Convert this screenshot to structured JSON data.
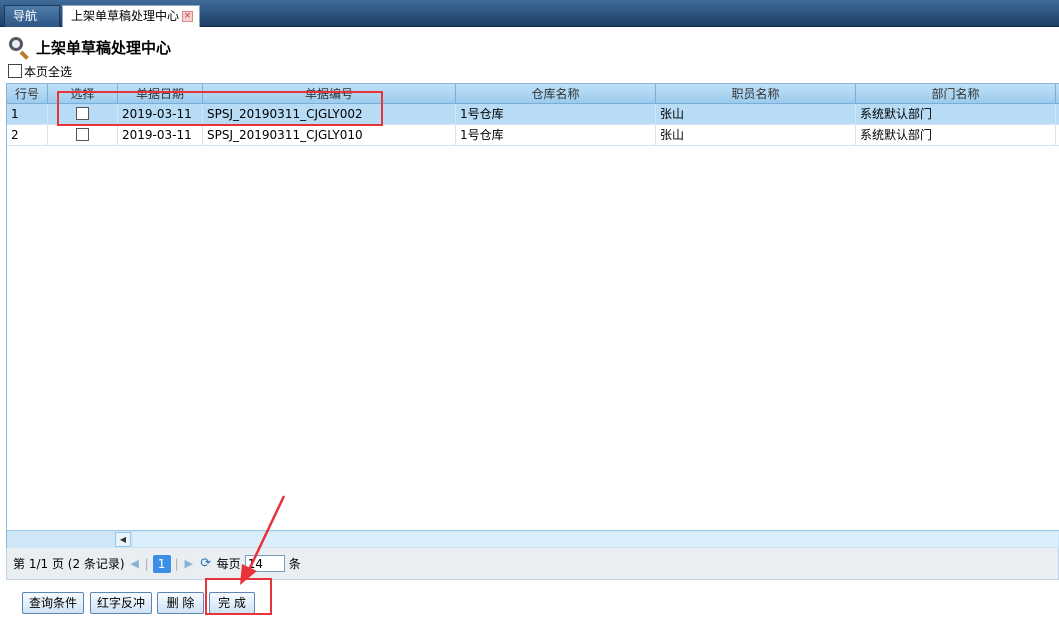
{
  "tabs": [
    {
      "label": "导航"
    },
    {
      "label": "上架单草稿处理中心"
    }
  ],
  "page": {
    "title": "上架单草稿处理中心",
    "select_all_label": "本页全选"
  },
  "grid": {
    "columns": [
      "行号",
      "选择",
      "单据日期",
      "单据编号",
      "仓库名称",
      "职员名称",
      "部门名称"
    ],
    "rows": [
      {
        "no": "1",
        "date": "2019-03-11",
        "code": "SPSJ_20190311_CJGLY002",
        "warehouse": "1号仓库",
        "staff": "张山",
        "dept": "系统默认部门"
      },
      {
        "no": "2",
        "date": "2019-03-11",
        "code": "SPSJ_20190311_CJGLY010",
        "warehouse": "1号仓库",
        "staff": "张山",
        "dept": "系统默认部门"
      }
    ]
  },
  "pager": {
    "page_info": "第 1/1 页 (2 条记录)",
    "current_page": "1",
    "per_page_label": "每页",
    "page_size": "14",
    "unit": "条"
  },
  "buttons": {
    "query": "查询条件",
    "reverse": "红字反冲",
    "delete": "删 除",
    "complete": "完 成"
  },
  "colors": {
    "annotation": "#e8333a",
    "selected_row": "#b8dcf5",
    "header": "#9ccbed"
  }
}
